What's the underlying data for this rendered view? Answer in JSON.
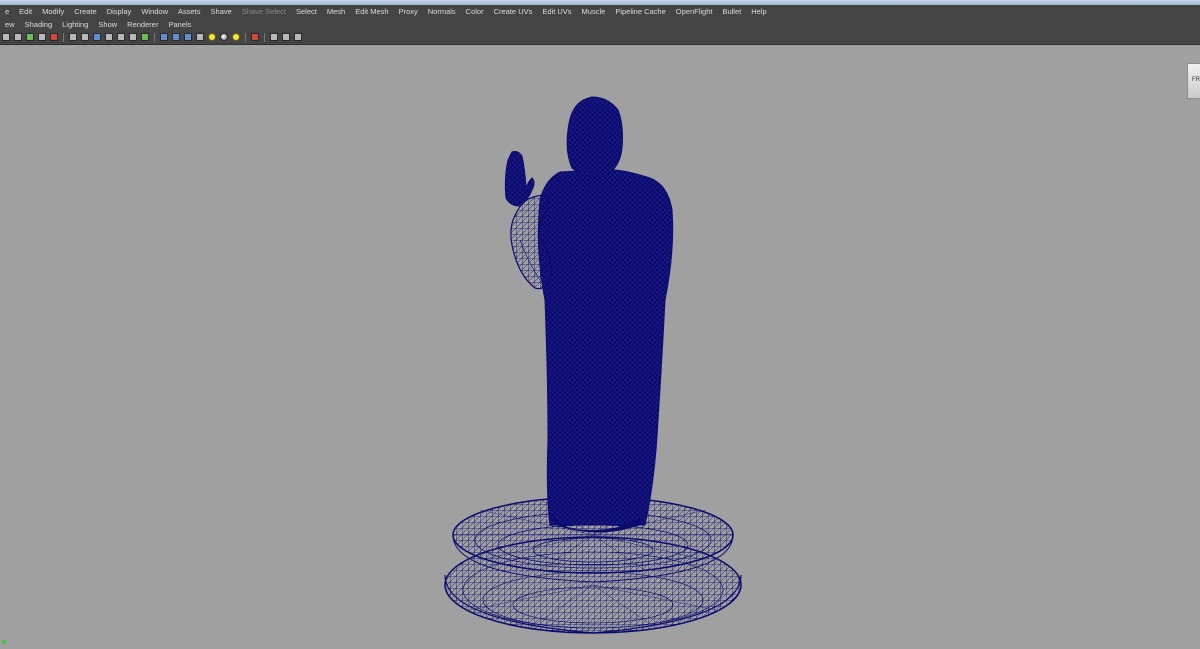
{
  "menubar": {
    "items": [
      "e",
      "Edit",
      "Modify",
      "Create",
      "Display",
      "Window",
      "Assets",
      "Shave",
      "Shave Select",
      "Select",
      "Mesh",
      "Edit Mesh",
      "Proxy",
      "Normals",
      "Color",
      "Create UVs",
      "Edit UVs",
      "Muscle",
      "Pipeline Cache",
      "OpenFlight",
      "Bullet",
      "Help"
    ]
  },
  "panel_menu": {
    "items": [
      "ew",
      "Shading",
      "Lighting",
      "Show",
      "Renderer",
      "Panels"
    ]
  },
  "viewcube": {
    "label": "FR"
  },
  "colors": {
    "viewport_bg": "#a0a0a0",
    "wireframe": "#0b0b6e",
    "ui_bar": "#444444"
  }
}
